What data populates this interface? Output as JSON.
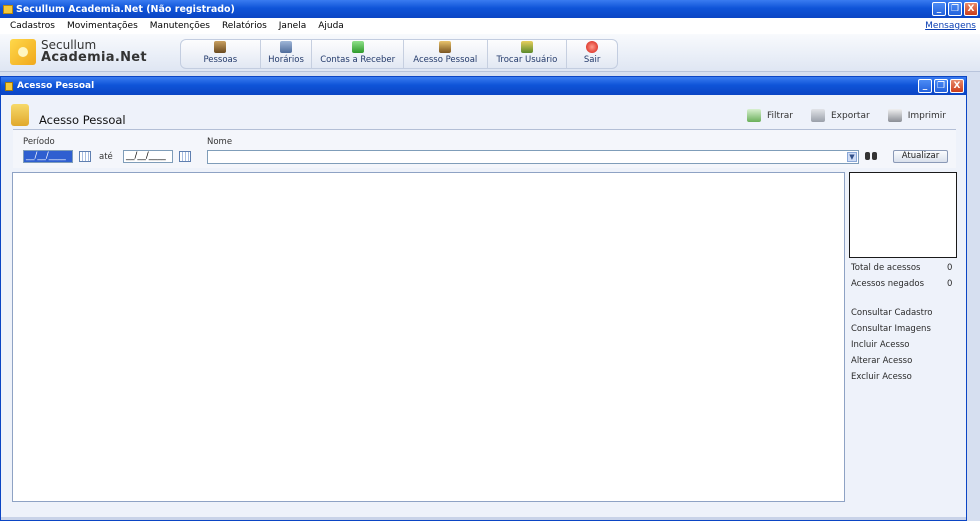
{
  "app": {
    "title": "Secullum Academia.Net (Não registrado)",
    "window_buttons": [
      "_",
      "❐",
      "X"
    ]
  },
  "menu": {
    "items": [
      "Cadastros",
      "Movimentações",
      "Manutenções",
      "Relatórios",
      "Janela",
      "Ajuda"
    ],
    "messages_link": "Mensagens"
  },
  "logo": {
    "line1": "Secullum",
    "line2": "Academia.Net"
  },
  "toolbar": {
    "items": [
      {
        "label": "Pessoas",
        "icon": "people-icon"
      },
      {
        "label": "Horários",
        "icon": "calendar-icon"
      },
      {
        "label": "Contas a Receber",
        "icon": "add-money-icon"
      },
      {
        "label": "Acesso Pessoal",
        "icon": "person-access-icon"
      },
      {
        "label": "Trocar Usuário",
        "icon": "switch-user-icon"
      },
      {
        "label": "Sair",
        "icon": "power-icon"
      }
    ]
  },
  "child_window": {
    "title": "Acesso Pessoal",
    "header_title": "Acesso Pessoal",
    "actions": {
      "filter": "Filtrar",
      "export": "Exportar",
      "print": "Imprimir"
    },
    "filter": {
      "period_label": "Período",
      "date_from": "__/__/____",
      "until_label": "até",
      "date_to": "__/__/____",
      "name_label": "Nome",
      "name_value": "",
      "update_button": "Atualizar"
    },
    "summary": {
      "total_label": "Total de acessos",
      "total_value": "0",
      "denied_label": "Acessos negados",
      "denied_value": "0"
    },
    "side_links": [
      "Consultar Cadastro",
      "Consultar Imagens",
      "Incluir Acesso",
      "Alterar Acesso",
      "Excluir Acesso"
    ]
  },
  "colors": {
    "titlebar": "#0f54d8",
    "accent": "#f3c93c",
    "link": "#0b3fb3"
  }
}
